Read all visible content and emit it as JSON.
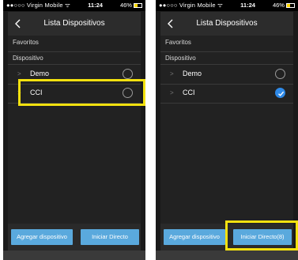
{
  "status_bar": {
    "carrier": "●●○○○ Virgin Mobile ᯤ",
    "time": "11:24",
    "battery": "46%"
  },
  "screens": [
    {
      "header": {
        "title": "Lista Dispositivos"
      },
      "sections": {
        "favorites": "Favoritos",
        "devices": "Dispositivo"
      },
      "devices": [
        {
          "label": "Demo",
          "checked": false
        },
        {
          "label": "CCI",
          "checked": false
        }
      ],
      "footer": {
        "add_label": "Agregar dispositivo",
        "live_label": "Iniciar Directo"
      }
    },
    {
      "header": {
        "title": "Lista Dispositivos"
      },
      "sections": {
        "favorites": "Favoritos",
        "devices": "Dispositivo"
      },
      "devices": [
        {
          "label": "Demo",
          "checked": false
        },
        {
          "label": "CCI",
          "checked": true
        }
      ],
      "footer": {
        "add_label": "Agregar dispositivo",
        "live_label": "Iniciar Directo(8)"
      }
    }
  ],
  "colors": {
    "highlight": "#f3e10f",
    "button": "#5aa9dd",
    "checked": "#2f8ae8",
    "panel": "#222222"
  }
}
